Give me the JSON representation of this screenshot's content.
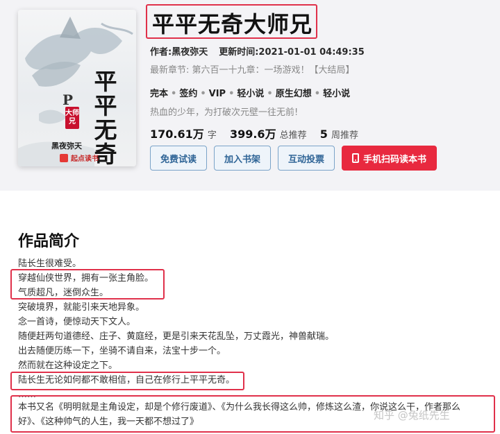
{
  "cover": {
    "title_chars": "平平无奇",
    "red_label": "大师兄",
    "author": "黑夜弥天",
    "logo_text": "起点读书",
    "letter": "P"
  },
  "book": {
    "title": "平平无奇大师兄",
    "author_label": "作者:",
    "author": "黑夜弥天",
    "update_label": "更新时间:",
    "update_time": "2021-01-01 04:49:35",
    "latest_label": "最新章节:",
    "latest_chapter": "第六百一十九章：一场游戏！【大结局】",
    "tags": [
      "完本",
      "签约",
      "VIP",
      "轻小说",
      "原生幻想",
      "轻小说"
    ],
    "tagline": "热血的少年，为打破次元壁一往无前!",
    "stats": [
      {
        "num": "170.61万",
        "unit": "字"
      },
      {
        "num": "399.6万",
        "unit": "总推荐"
      },
      {
        "num": "5",
        "unit": "周推荐"
      }
    ],
    "buttons": {
      "free_read": "免费试读",
      "add_shelf": "加入书架",
      "vote": "互动投票",
      "mobile": "手机扫码读本书"
    }
  },
  "intro": {
    "heading": "作品简介",
    "lines": [
      "陆长生很难受。",
      "穿越仙侠世界，拥有一张主角脸。",
      "气质超凡，迷倒众生。",
      "突破境界，就能引来天地异象。",
      "念一首诗，便惊动天下文人。",
      "随便赶两句道德经、庄子、黄庭经，更是引来天花乱坠，万丈霞光，神兽献瑞。",
      "出去随便历练一下，坐骑不请自来，法宝十步一个。",
      "然而就在这种设定之下。",
      "陆长生无论如何都不敢相信，自己在修行上平平无奇。"
    ],
    "dots": "……",
    "long_line_1": "本书又名《明明就是主角设定，却是个修行废道》、《为什么我长得这么帅，修炼这么渣，你说这么干，作者那么",
    "long_line_2": "好》、《这种帅气的人生，我一天都不想过了》"
  },
  "watermark": "知乎 @兔纸先生"
}
